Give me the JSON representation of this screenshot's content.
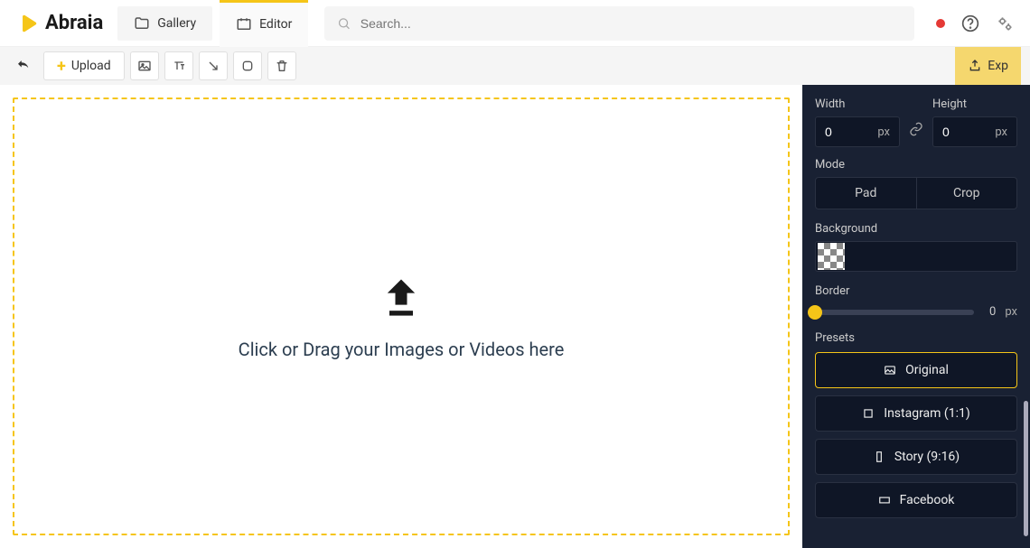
{
  "header": {
    "brand": "Abraia",
    "tabs": {
      "gallery": "Gallery",
      "editor": "Editor"
    },
    "search_placeholder": "Search..."
  },
  "toolbar": {
    "upload": "Upload",
    "export": "Exp"
  },
  "canvas": {
    "drop_text": "Click or Drag your Images or Videos here"
  },
  "panel": {
    "width_label": "Width",
    "height_label": "Height",
    "width_value": "0",
    "height_value": "0",
    "unit": "px",
    "mode_label": "Mode",
    "mode_pad": "Pad",
    "mode_crop": "Crop",
    "background_label": "Background",
    "border_label": "Border",
    "border_value": "0",
    "presets_label": "Presets",
    "presets": {
      "original": "Original",
      "instagram": "Instagram (1:1)",
      "story": "Story (9:16)",
      "facebook": "Facebook"
    }
  }
}
